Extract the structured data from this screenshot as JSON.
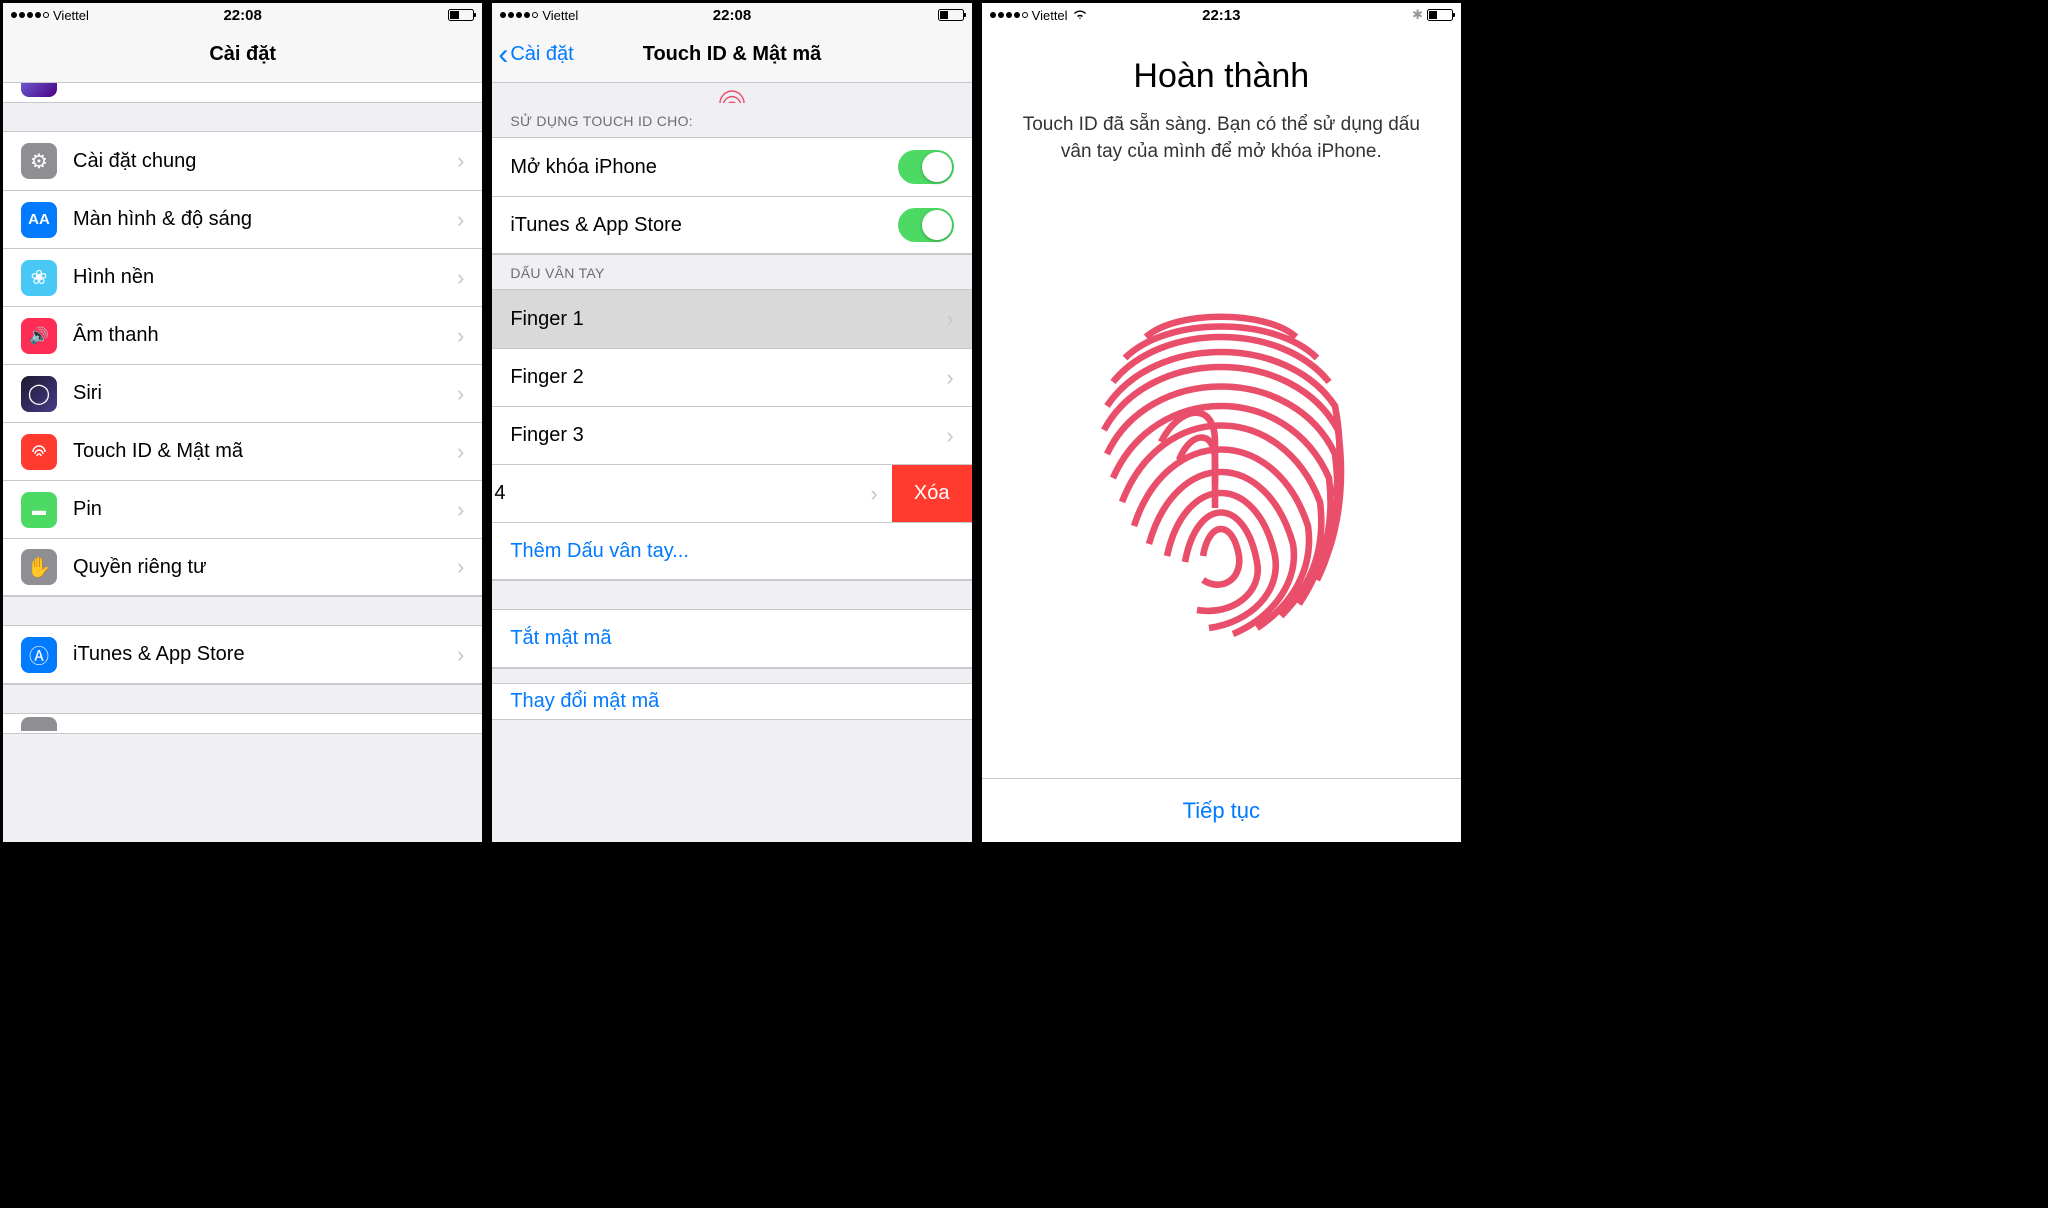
{
  "screen1": {
    "status": {
      "carrier": "Viettel",
      "time": "22:08"
    },
    "nav_title": "Cài đặt",
    "items": [
      {
        "label": "Cài đặt chung",
        "icon": "gear-icon",
        "bg": "ic-gray",
        "glyph": "⚙"
      },
      {
        "label": "Màn hình & độ sáng",
        "icon": "display-icon",
        "bg": "ic-blue",
        "glyph": "AA"
      },
      {
        "label": "Hình nền",
        "icon": "wallpaper-icon",
        "bg": "ic-cyan",
        "glyph": "❀"
      },
      {
        "label": "Âm thanh",
        "icon": "sound-icon",
        "bg": "ic-red2",
        "glyph": "🔊"
      },
      {
        "label": "Siri",
        "icon": "siri-icon",
        "bg": "ic-siri",
        "glyph": "◯"
      },
      {
        "label": "Touch ID & Mật mã",
        "icon": "touchid-icon",
        "bg": "ic-red",
        "glyph": "◉"
      },
      {
        "label": "Pin",
        "icon": "battery-icon",
        "bg": "ic-green",
        "glyph": "▬"
      },
      {
        "label": "Quyền riêng tư",
        "icon": "privacy-icon",
        "bg": "ic-gray",
        "glyph": "✋"
      }
    ],
    "bottom_item": {
      "label": "iTunes & App Store",
      "icon": "appstore-icon",
      "bg": "ic-blue",
      "glyph": "Ⓐ"
    }
  },
  "screen2": {
    "status": {
      "carrier": "Viettel",
      "time": "22:08"
    },
    "nav_back": "Cài đặt",
    "nav_title": "Touch ID & Mật mã",
    "section1_header": "SỬ DỤNG TOUCH ID CHO:",
    "toggles": [
      {
        "label": "Mở khóa iPhone",
        "on": true
      },
      {
        "label": "iTunes & App Store",
        "on": true
      }
    ],
    "section2_header": "DẤU VÂN TAY",
    "fingers": [
      {
        "label": "Finger 1",
        "selected": true
      },
      {
        "label": "Finger 2"
      },
      {
        "label": "Finger 3"
      },
      {
        "label": "4",
        "swipe": true
      }
    ],
    "delete_label": "Xóa",
    "add_label": "Thêm Dấu vân tay...",
    "turn_off_label": "Tắt mật mã",
    "change_label": "Thay đổi mật mã"
  },
  "screen3": {
    "status": {
      "carrier": "Viettel",
      "time": "22:13"
    },
    "title": "Hoàn thành",
    "description": "Touch ID đã sẵn sàng. Bạn có thể sử dụng dấu vân tay của mình để mở khóa iPhone.",
    "continue_label": "Tiếp tục"
  }
}
